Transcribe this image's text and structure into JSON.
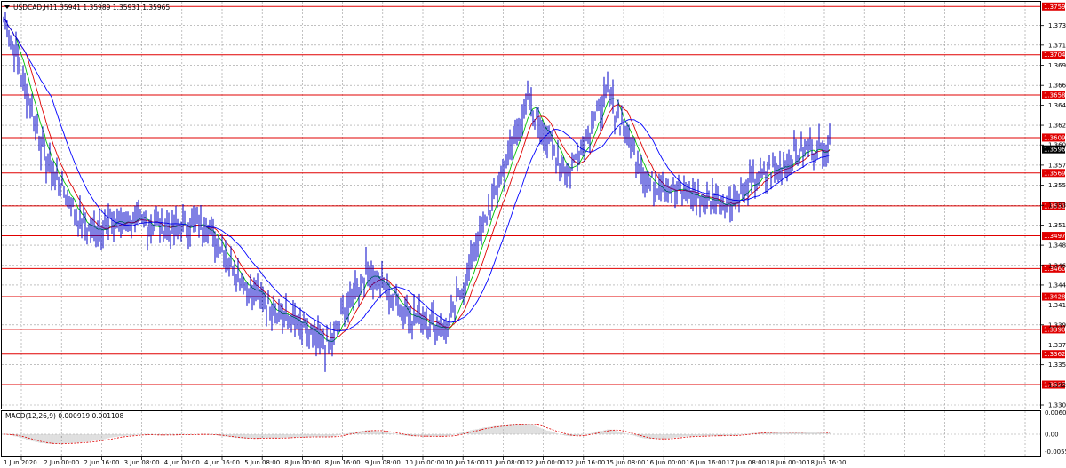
{
  "window": {
    "symbol_title": "USDCAD,H1",
    "ohlc_text": "1.35941 1.35989 1.35931 1.35965",
    "menu_icon": "triangle-down-icon"
  },
  "price_axis": {
    "min": 1.33045,
    "max": 1.3761,
    "ticks": [
      "1.37380",
      "1.37155",
      "1.36925",
      "1.36695",
      "1.36470",
      "1.36240",
      "1.36015",
      "1.35785",
      "1.35555",
      "1.35325",
      "1.35100",
      "1.34870",
      "1.34640",
      "1.34415",
      "1.34185",
      "1.33960",
      "1.33730",
      "1.33505",
      "1.33275",
      "1.33045"
    ]
  },
  "current_price": {
    "value": "1.35965",
    "color": "#000000"
  },
  "levels": [
    {
      "value": 1.37597,
      "label": "1.37597"
    },
    {
      "value": 1.37045,
      "label": "1.37045"
    },
    {
      "value": 1.36585,
      "label": "1.36585"
    },
    {
      "value": 1.36099,
      "label": "1.36099"
    },
    {
      "value": 1.35695,
      "label": "1.35695"
    },
    {
      "value": 1.35318,
      "label": "1.35318"
    },
    {
      "value": 1.34977,
      "label": "1.34977"
    },
    {
      "value": 1.34604,
      "label": "1.34604"
    },
    {
      "value": 1.34282,
      "label": "1.34282"
    },
    {
      "value": 1.33908,
      "label": "1.33908"
    },
    {
      "value": 1.33626,
      "label": "1.33626"
    },
    {
      "value": 1.33278,
      "label": "1.33278"
    }
  ],
  "macd": {
    "title": "MACD(12,26,9) 0.000919 0.001108",
    "ticks": [
      "0.006051",
      "0.00",
      "-0.0055"
    ]
  },
  "time_axis": {
    "labels": [
      "1 Jun 2020",
      "2 Jun 00:00",
      "2 Jun 16:00",
      "3 Jun 08:00",
      "4 Jun 00:00",
      "4 Jun 16:00",
      "5 Jun 08:00",
      "8 Jun 00:00",
      "8 Jun 16:00",
      "9 Jun 08:00",
      "10 Jun 00:00",
      "10 Jun 16:00",
      "11 Jun 08:00",
      "12 Jun 00:00",
      "12 Jun 16:00",
      "15 Jun 08:00",
      "16 Jun 00:00",
      "16 Jun 16:00",
      "17 Jun 08:00",
      "18 Jun 00:00",
      "18 Jun 16:00"
    ]
  },
  "chart_data": {
    "type": "line",
    "title": "USDCAD,H1",
    "ylim": [
      1.33045,
      1.3761
    ],
    "key_closes": [
      {
        "x": "1 Jun 2020",
        "y": 1.3745
      },
      {
        "x": "2 Jun 00:00",
        "y": 1.3585
      },
      {
        "x": "2 Jun 16:00",
        "y": 1.3505
      },
      {
        "x": "3 Jun 08:00",
        "y": 1.3515
      },
      {
        "x": "4 Jun 00:00",
        "y": 1.3508
      },
      {
        "x": "4 Jun 16:00",
        "y": 1.351
      },
      {
        "x": "5 Jun 08:00",
        "y": 1.344
      },
      {
        "x": "8 Jun 00:00",
        "y": 1.3405
      },
      {
        "x": "8 Jun 16:00",
        "y": 1.337
      },
      {
        "x": "9 Jun 08:00",
        "y": 1.346
      },
      {
        "x": "10 Jun 00:00",
        "y": 1.341
      },
      {
        "x": "10 Jun 16:00",
        "y": 1.339
      },
      {
        "x": "11 Jun 08:00",
        "y": 1.352
      },
      {
        "x": "12 Jun 00:00",
        "y": 1.365
      },
      {
        "x": "12 Jun 16:00",
        "y": 1.357
      },
      {
        "x": "15 Jun 08:00",
        "y": 1.366
      },
      {
        "x": "16 Jun 00:00",
        "y": 1.356
      },
      {
        "x": "16 Jun 16:00",
        "y": 1.3545
      },
      {
        "x": "17 Jun 08:00",
        "y": 1.3535
      },
      {
        "x": "18 Jun 00:00",
        "y": 1.357
      },
      {
        "x": "18 Jun 16:00",
        "y": 1.3597
      }
    ],
    "series_colors": {
      "price": "#0000c8",
      "ma_green": "#00c000",
      "ma_red": "#e00000",
      "ma_blue": "#0000ff"
    },
    "grid": true
  }
}
